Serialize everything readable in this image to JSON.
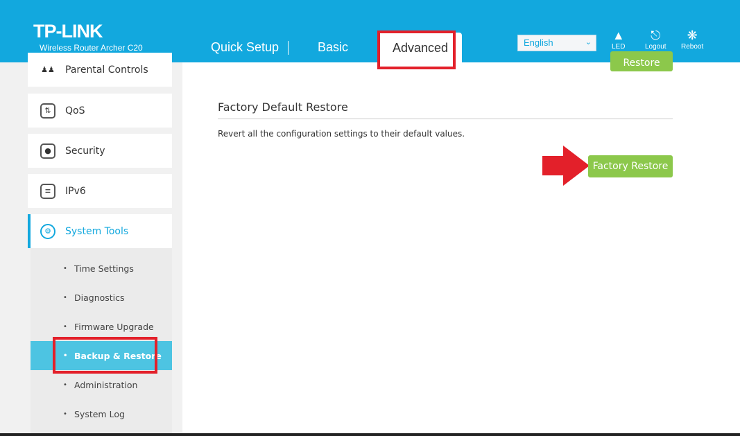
{
  "header": {
    "brand": "TP-LINK",
    "model": "Wireless Router Archer C20",
    "tabs": [
      {
        "label": "Quick Setup"
      },
      {
        "label": "Basic"
      },
      {
        "label": "Advanced",
        "active": true
      }
    ],
    "language": "English",
    "icons": [
      {
        "name": "led-icon",
        "label": "LED"
      },
      {
        "name": "logout-icon",
        "label": "Logout"
      },
      {
        "name": "reboot-icon",
        "label": "Reboot"
      }
    ],
    "color": "#12a8de"
  },
  "sidebar": {
    "items": [
      {
        "label": "Parental Controls",
        "icon": "parental-controls-icon"
      },
      {
        "label": "QoS",
        "icon": "qos-icon"
      },
      {
        "label": "Security",
        "icon": "lock-icon"
      },
      {
        "label": "IPv6",
        "icon": "ipv6-icon"
      },
      {
        "label": "System Tools",
        "icon": "gear-icon",
        "active": true
      }
    ],
    "subitems": [
      {
        "label": "Time Settings"
      },
      {
        "label": "Diagnostics"
      },
      {
        "label": "Firmware Upgrade"
      },
      {
        "label": "Backup & Restore",
        "active": true
      },
      {
        "label": "Administration"
      },
      {
        "label": "System Log"
      }
    ]
  },
  "main": {
    "restore_button": "Restore",
    "section_title": "Factory Default Restore",
    "description": "Revert all the configuration settings to their default values.",
    "factory_restore_button": "Factory Restore",
    "button_color": "#8cc84b",
    "highlight_color": "#e3202a"
  }
}
